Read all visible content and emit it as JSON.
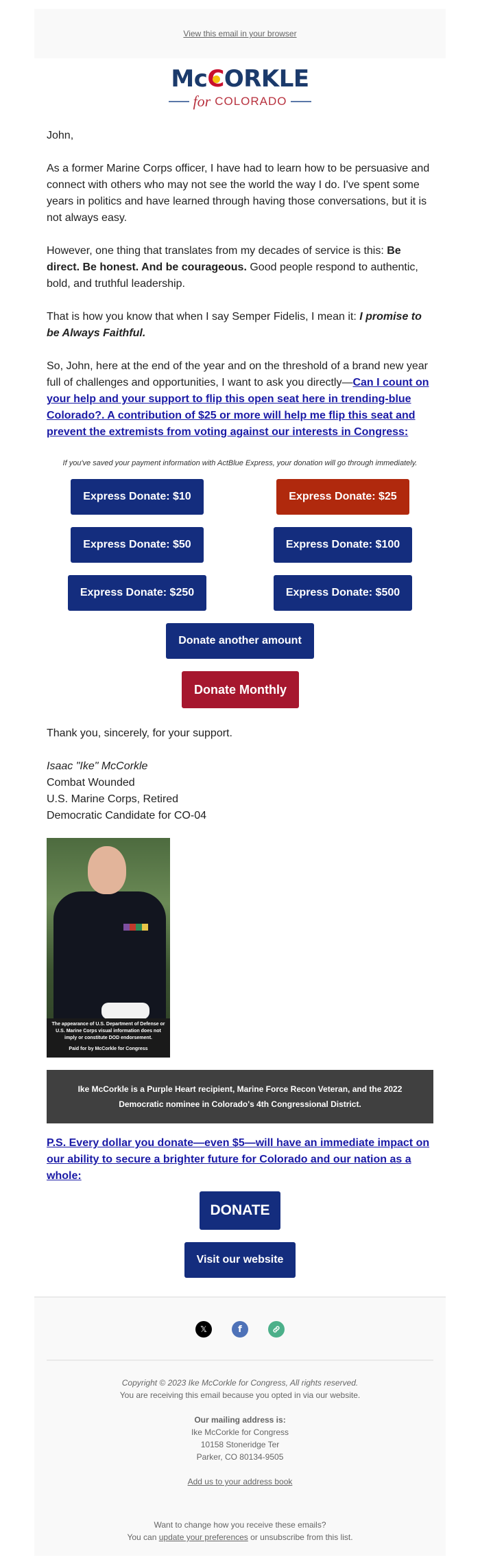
{
  "preheader": {
    "view_in_browser": "View this email in your browser"
  },
  "logo": {
    "name_prefix": "Mc",
    "name_c": "C",
    "name_suffix": "ORKLE",
    "tagline_for": "for",
    "tagline_state": "COLORADO",
    "colors": {
      "navy": "#1b3a6b",
      "red": "#c8102e",
      "gold": "#f4c20d"
    }
  },
  "body": {
    "greeting": "John,",
    "p1": "As a former Marine Corps officer, I have had to learn how to be persuasive and connect with others who may not see the world the way I do. I've spent some years in politics and have learned through having those conversations, but it is not always easy.",
    "p2_lead": "However, one thing that translates from my decades of service is this: ",
    "p2_bold": "Be direct. Be honest. And be courageous.",
    "p2_tail": " Good people respond to authentic, bold, and truthful leadership.",
    "p3_lead": "That is how you know that when I say Semper Fidelis, I mean it: ",
    "p3_bold_italic": "I promise to be Always Faithful.",
    "p4_lead": "So, John, here at the end of the year and on the threshold of a brand new year full of challenges and opportunities, I want to ask you directly—",
    "p4_link": "Can I count on your help and your support to flip this open seat here in trending-blue Colorado?. A contribution of $25 or more will help me flip this seat and prevent the extremists from voting against our interests in Congress:"
  },
  "actblue_note": "If you've saved your payment information with ActBlue Express, your donation will go through immediately.",
  "donate_buttons": [
    {
      "label": "Express Donate: $10",
      "amount": 10,
      "color": "#142d7e"
    },
    {
      "label": "Express Donate: $25",
      "amount": 25,
      "color": "#b0290d"
    },
    {
      "label": "Express Donate: $50",
      "amount": 50,
      "color": "#142d7e"
    },
    {
      "label": "Express Donate: $100",
      "amount": 100,
      "color": "#142d7e"
    },
    {
      "label": "Express Donate: $250",
      "amount": 250,
      "color": "#142d7e"
    },
    {
      "label": "Express Donate: $500",
      "amount": 500,
      "color": "#142d7e"
    }
  ],
  "other_amount_label": "Donate another amount",
  "monthly_label": "Donate Monthly",
  "signoff": {
    "thanks": "Thank you, sincerely, for your support.",
    "name": "Isaac \"Ike\" McCorkle",
    "line1": "Combat Wounded",
    "line2": "U.S. Marine Corps, Retired",
    "line3": "Democratic Candidate for CO-04"
  },
  "photo": {
    "caption_disclaimer": "The appearance of U.S. Department of Defense or U.S. Marine Corps visual information does not imply or constitute DOD endorsement.",
    "caption_paid_for": "Paid for by McCorkle for Congress"
  },
  "bio_banner": "Ike McCorkle is a Purple Heart recipient, Marine Force Recon Veteran, and the 2022 Democratic nominee in Colorado's 4th Congressional District.",
  "ps_link": "P.S. Every dollar you donate—even $5—will have an immediate impact on our ability to secure a brighter future for Colorado and our nation as a whole:",
  "donate_label": "DONATE",
  "website_label": "Visit our website",
  "footer": {
    "social": [
      {
        "name": "x",
        "glyph": "𝕏"
      },
      {
        "name": "facebook",
        "glyph": "f"
      },
      {
        "name": "website-link",
        "glyph": "🔗"
      }
    ],
    "copyright": "Copyright © 2023 Ike McCorkle for Congress, All rights reserved.",
    "opt_in": "You are receiving this email because you opted in via our website.",
    "mailing_heading": "Our mailing address is:",
    "address_org": "Ike McCorkle for Congress",
    "address_street": "10158 Stoneridge Ter",
    "address_city": "Parker, CO 80134-9505",
    "address_book_link": "Add us to your address book",
    "change_prompt": "Want to change how you receive these emails?",
    "prefs_lead": "You can ",
    "prefs_link": "update your preferences",
    "prefs_tail": " or unsubscribe from this list."
  }
}
